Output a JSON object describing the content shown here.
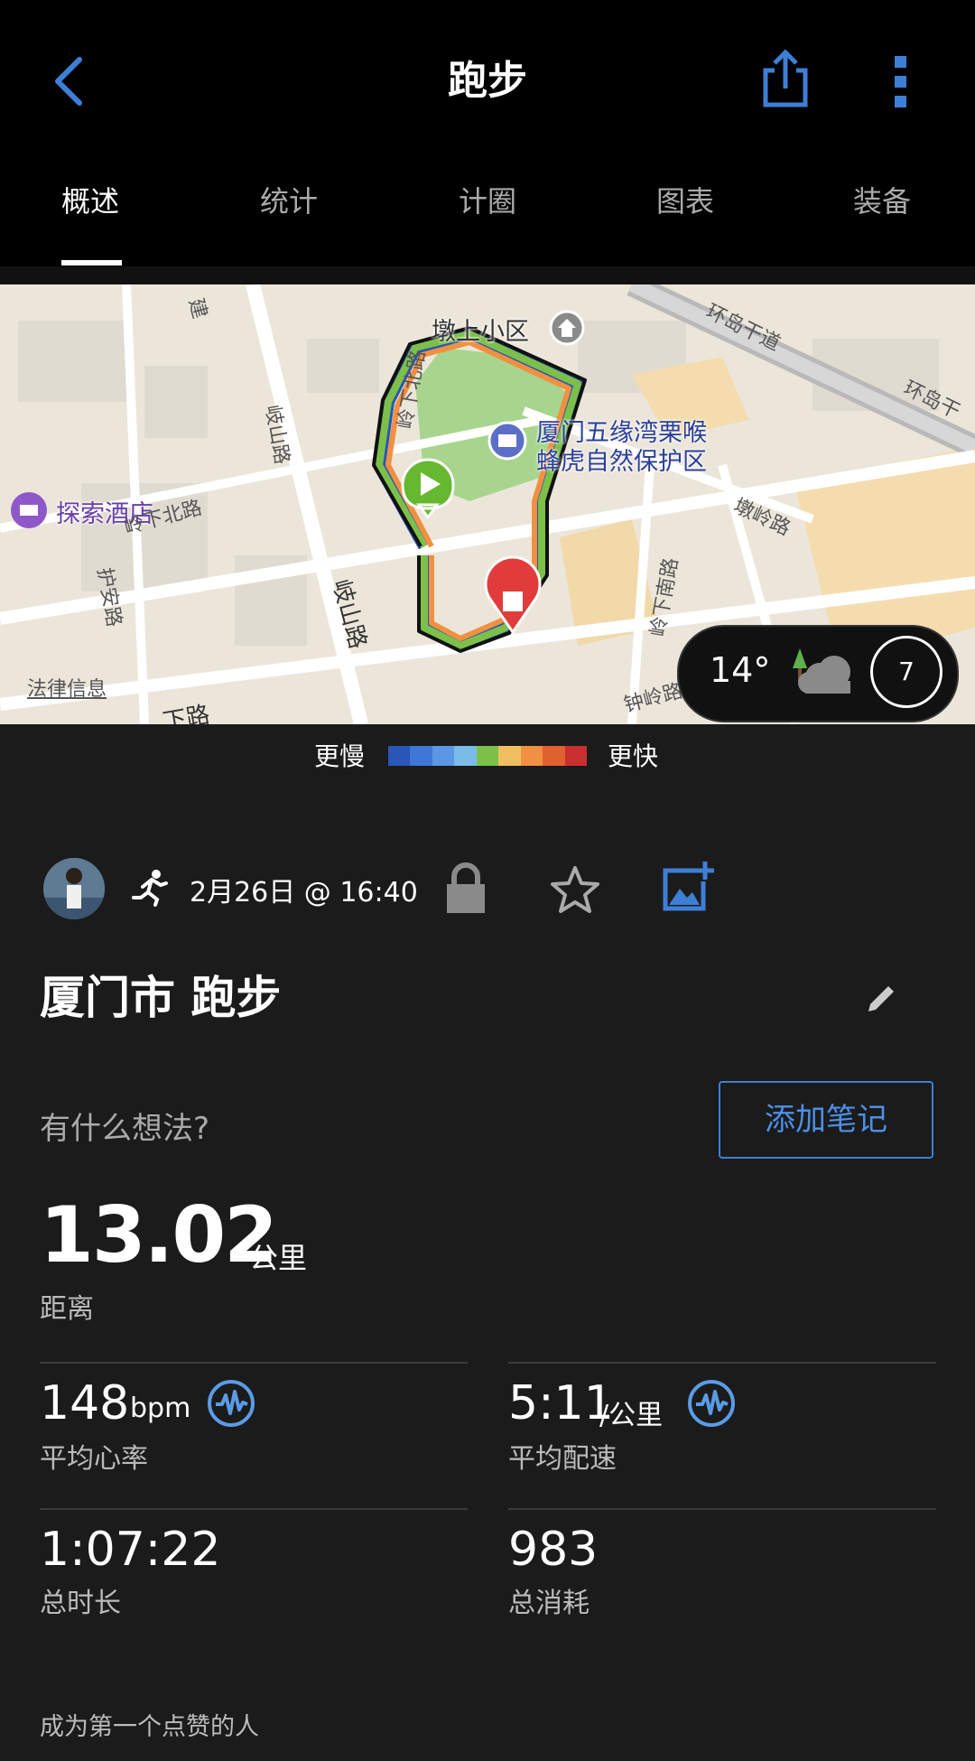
{
  "header": {
    "title": "跑步"
  },
  "tabs": [
    "概述",
    "统计",
    "计圈",
    "图表",
    "装备"
  ],
  "map": {
    "pois": [
      "墩上小区",
      "厦门五缘湾栗喉",
      "蜂虎自然保护区",
      "探索酒店",
      "法律信息"
    ],
    "streets": [
      "环岛干道",
      "环岛干",
      "岐山路",
      "岭下北路",
      "岭下北路",
      "护安路",
      "墩岭路",
      "岭下南路",
      "钟岭路",
      "岐山路",
      "建",
      "下路"
    ],
    "weather": {
      "temp": "14°",
      "wind": "7"
    }
  },
  "legend": {
    "slow": "更慢",
    "fast": "更快",
    "colors": [
      "#2a56b8",
      "#3f77d6",
      "#5b97e6",
      "#7bbbe8",
      "#7cc04a",
      "#f0c060",
      "#f09040",
      "#e06030",
      "#c83030"
    ]
  },
  "activity": {
    "datetime": "2月26日 @ 16:40",
    "title": "厦门市 跑步",
    "prompt": "有什么想法?",
    "add_note": "添加笔记"
  },
  "stats": {
    "distance": {
      "value": "13.02",
      "unit": "公里",
      "label": "距离"
    },
    "heart_rate": {
      "value": "148",
      "unit": "bpm",
      "label": "平均心率"
    },
    "pace": {
      "value": "5:11",
      "unit": "/公里",
      "label": "平均配速"
    },
    "duration": {
      "value": "1:07:22",
      "label": "总时长"
    },
    "calories": {
      "value": "983",
      "label": "总消耗"
    }
  },
  "likes": "成为第一个点赞的人",
  "colors": {
    "accent": "#3d7fd6",
    "background": "#1b1b1b"
  }
}
